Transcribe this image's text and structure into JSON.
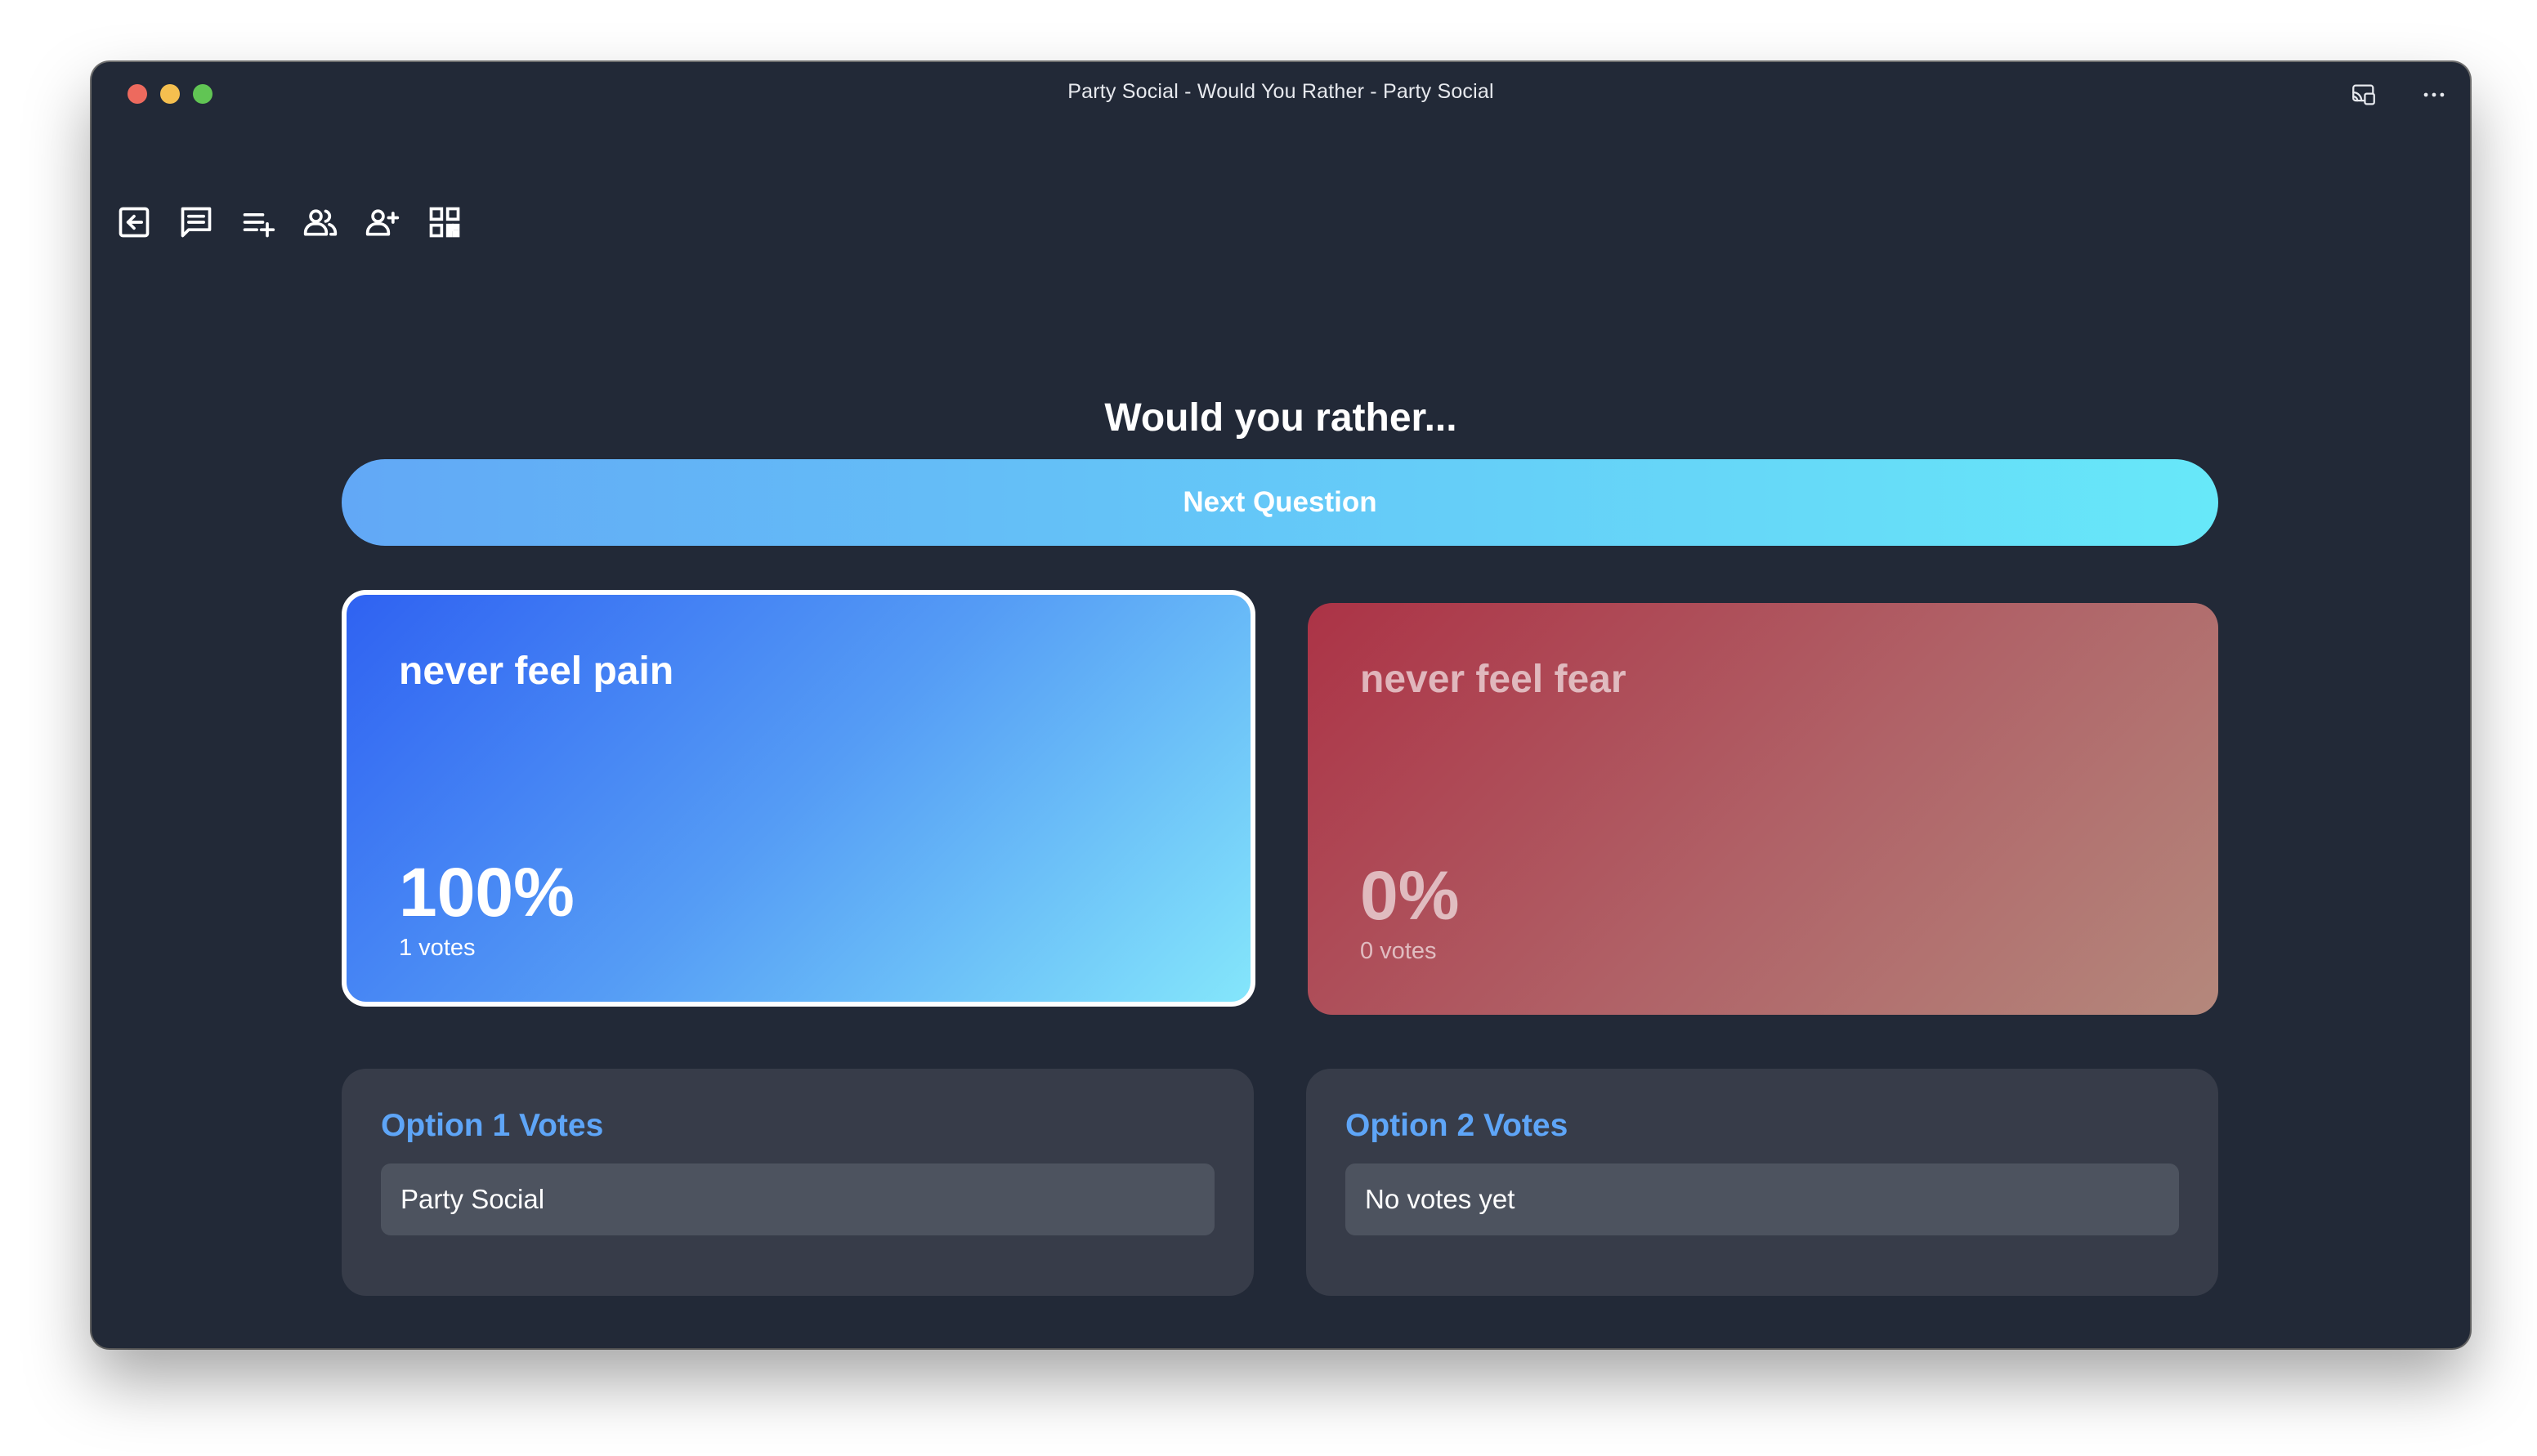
{
  "window": {
    "title": "Party Social - Would You Rather - Party Social"
  },
  "toolbar": {
    "items": [
      {
        "icon": "exit-icon"
      },
      {
        "icon": "chat-icon"
      },
      {
        "icon": "add-question-icon"
      },
      {
        "icon": "players-icon"
      },
      {
        "icon": "add-player-icon"
      },
      {
        "icon": "qr-code-icon"
      }
    ]
  },
  "main": {
    "heading": "Would you rather...",
    "next_button": "Next Question",
    "option1": {
      "text": "never feel pain",
      "percent": "100%",
      "votes": "1 votes"
    },
    "option2": {
      "text": "never feel fear",
      "percent": "0%",
      "votes": "0 votes"
    },
    "votes1": {
      "title": "Option 1 Votes",
      "items": [
        "Party Social"
      ]
    },
    "votes2": {
      "title": "Option 2 Votes",
      "items": [
        "No votes yet"
      ]
    }
  },
  "colors": {
    "background": "#222937",
    "option1_gradient": [
      "#2f62f2",
      "#84e6fb"
    ],
    "option2_gradient": [
      "#ac3346",
      "#b4887c"
    ],
    "next_button_gradient": [
      "#62a8f6",
      "#67e8f9"
    ],
    "votes_title": "#5ea5f7"
  }
}
